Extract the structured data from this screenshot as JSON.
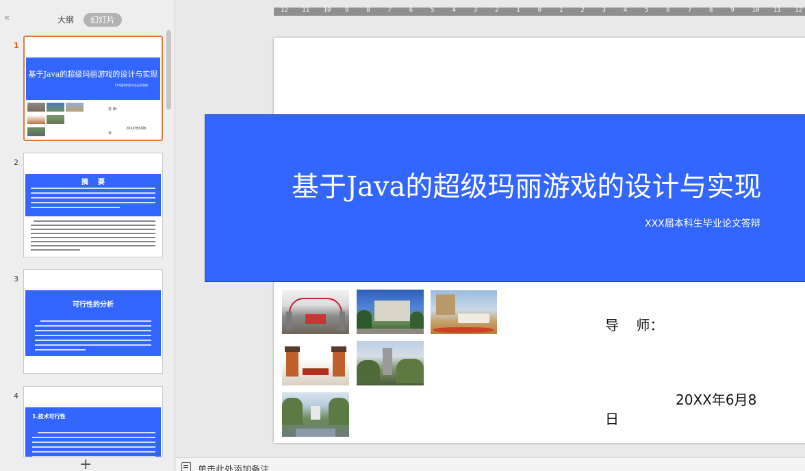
{
  "left_panel": {
    "collapse_glyph": "«",
    "tabs": [
      "大纲",
      "幻灯片"
    ],
    "active_tab": "幻灯片",
    "add_slide_glyph": "+"
  },
  "slides": [
    {
      "number": "1",
      "title": "基于Java的超级玛丽游戏的设计与实现",
      "subtitle": "XXX届本科生毕业论文答辩",
      "advisor": "导    师：",
      "date": "20XX年6月8",
      "date_tail": "日"
    },
    {
      "number": "2",
      "title": "摘    要"
    },
    {
      "number": "3",
      "title": "可行性的分析"
    },
    {
      "number": "4",
      "title": "1.技术可行性"
    }
  ],
  "ruler_labels": [
    "12",
    "11",
    "10",
    "9",
    "8",
    "7",
    "6",
    "5",
    "4",
    "3",
    "2",
    "1",
    "0",
    "1",
    "2",
    "3",
    "4",
    "5",
    "6",
    "7",
    "8",
    "9",
    "10",
    "11",
    "12"
  ],
  "main_slide": {
    "title": "基于Java的超级玛丽游戏的设计与实现",
    "subtitle": "XXX届本科生毕业论文答辩",
    "advisor": "导    师：",
    "date": "20XX年6月8",
    "date_tail": "日",
    "photos": [
      "campus-gate",
      "campus-building",
      "campus-sign",
      "campus-gate-towers",
      "campus-tower",
      "campus-courtyard"
    ],
    "banner_color": "#3366ff"
  },
  "notes": {
    "placeholder": "单击此处添加备注"
  }
}
